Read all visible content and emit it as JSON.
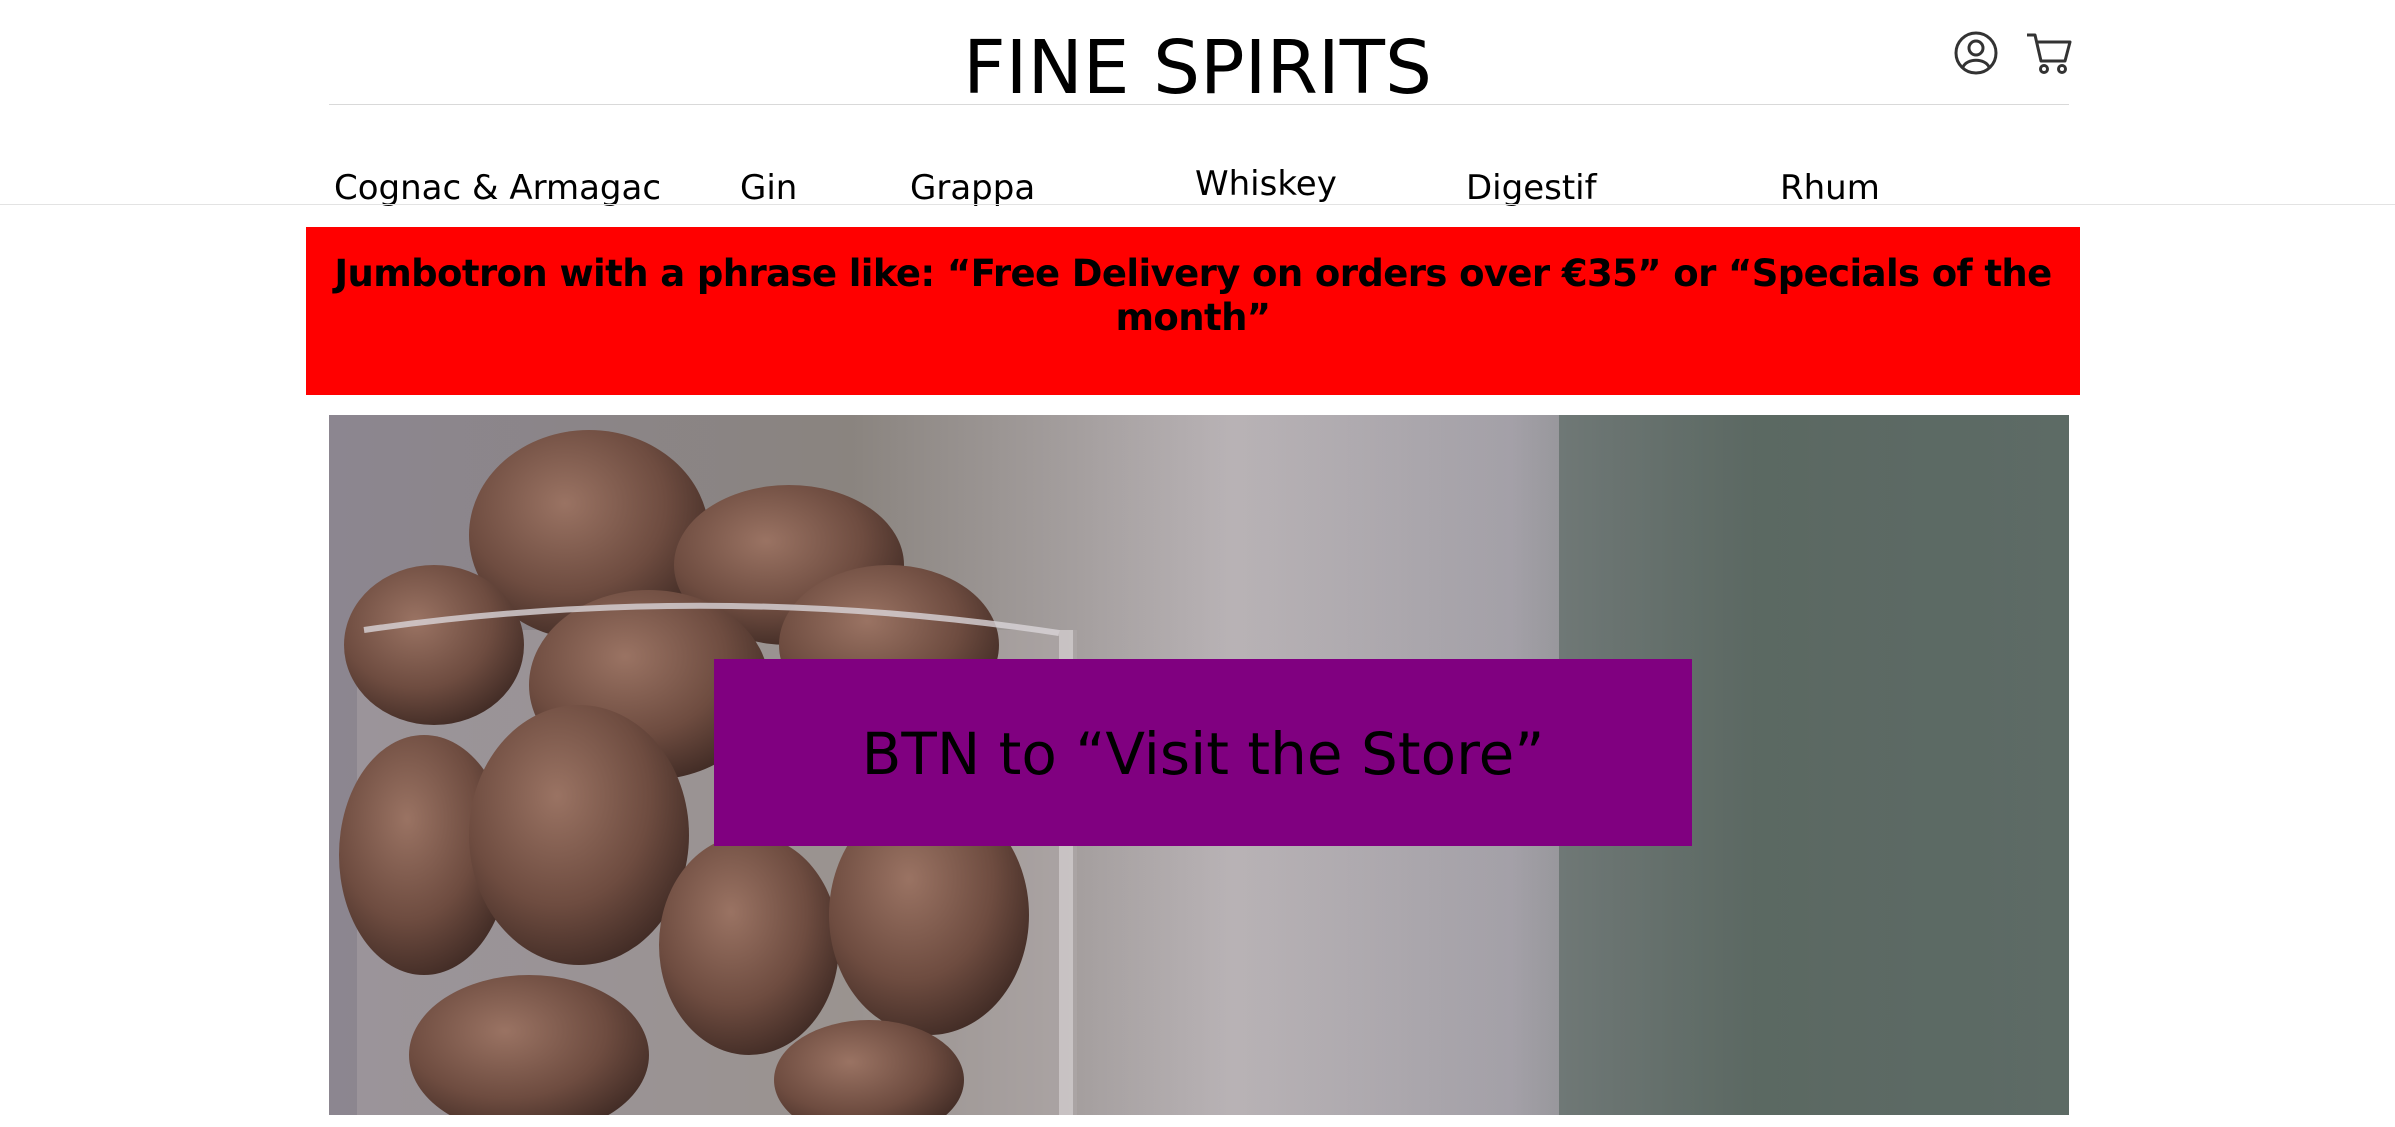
{
  "header": {
    "brand": "FINE SPIRITS",
    "account_icon": "user-circle-icon",
    "cart_icon": "shopping-cart-icon"
  },
  "nav": {
    "items": [
      {
        "label": "Cognac & Armagac"
      },
      {
        "label": "Gin"
      },
      {
        "label": "Grappa"
      },
      {
        "label": "Whiskey"
      },
      {
        "label": "Digestif"
      },
      {
        "label": "Rhum"
      }
    ]
  },
  "jumbotron": {
    "text": "Jumbotron with a phrase like: “Free Delivery on orders over €35” or “Specials of the month”",
    "color": "#ff0000"
  },
  "hero": {
    "image": "corks-in-glass-jar-photo",
    "button_label": "BTN to “Visit the Store”",
    "button_color": "#800080"
  }
}
